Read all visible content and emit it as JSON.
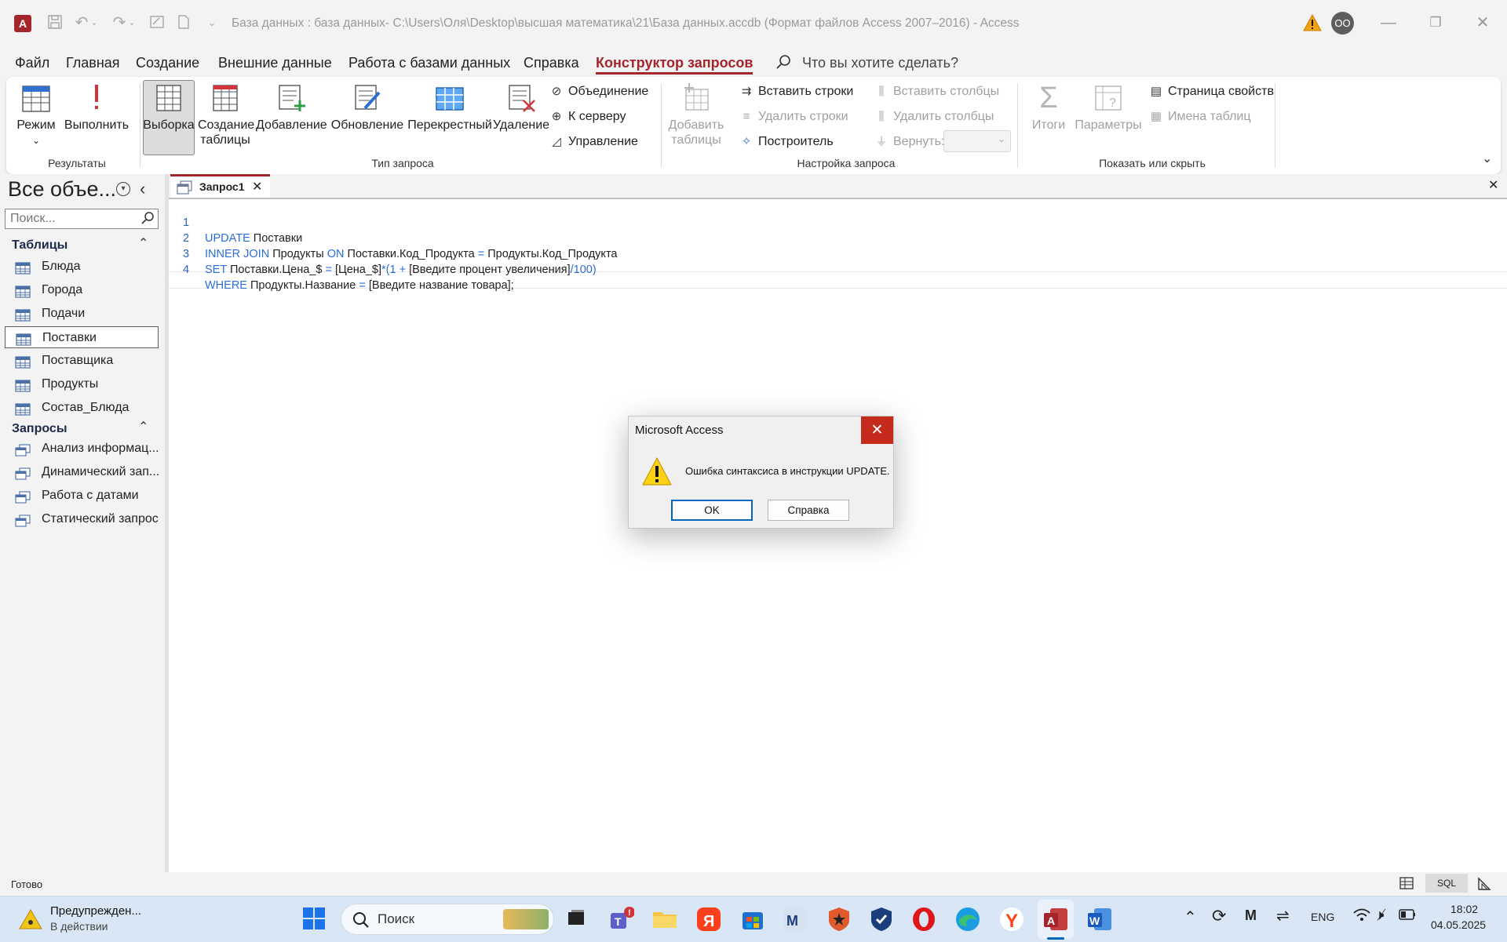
{
  "window": {
    "title": "База данных : база данных- C:\\Users\\Оля\\Desktop\\высшая математика\\21\\База данных.accdb (Формат файлов Access 2007–2016)  -  Access",
    "user_initials": "OO",
    "app_icon_letter": "A"
  },
  "menu": {
    "tabs": [
      "Файл",
      "Главная",
      "Создание",
      "Внешние данные",
      "Работа с базами данных",
      "Справка",
      "Конструктор запросов"
    ],
    "active_tab": "Конструктор запросов",
    "tell_me": "Что вы хотите сделать?"
  },
  "ribbon": {
    "results_group": {
      "label": "Результаты",
      "view": "Режим",
      "run": "Выполнить"
    },
    "query_type_group": {
      "label": "Тип запроса",
      "select": "Выборка",
      "make_table_1": "Создание",
      "make_table_2": "таблицы",
      "append": "Добавление",
      "update": "Обновление",
      "crosstab": "Перекрестный",
      "delete": "Удаление",
      "union": "Объединение",
      "pass_through": "К серверу",
      "data_definition": "Управление"
    },
    "setup_group": {
      "label": "Настройка запроса",
      "add_tables_1": "Добавить",
      "add_tables_2": "таблицы",
      "insert_rows": "Вставить строки",
      "delete_rows": "Удалить строки",
      "builder": "Построитель",
      "insert_columns": "Вставить столбцы",
      "delete_columns": "Удалить столбцы",
      "return": "Вернуть:"
    },
    "show_hide_group": {
      "label": "Показать или скрыть",
      "totals": "Итоги",
      "parameters": "Параметры",
      "property_sheet": "Страница свойств",
      "table_names": "Имена таблиц"
    }
  },
  "nav": {
    "header": "Все объе...",
    "search_placeholder": "Поиск...",
    "tables_section": "Таблицы",
    "tables": [
      "Блюда",
      "Города",
      "Подачи",
      "Поставки",
      "Поставщика",
      "Продукты",
      "Состав_Блюда"
    ],
    "selected_table": "Поставки",
    "queries_section": "Запросы",
    "queries": [
      "Анализ информац...",
      "Динамический зап...",
      "Работа с датами",
      "Статический запрос"
    ]
  },
  "document": {
    "tab_label": "Запрос1",
    "line_numbers": [
      "1",
      "2",
      "3",
      "4"
    ],
    "sql": {
      "l1_kw": "UPDATE",
      "l1_rest": " Поставки",
      "l2_kw1": "INNER JOIN",
      "l2_a": " Продукты ",
      "l2_kw2": "ON",
      "l2_b": " Поставки.Код_Продукта ",
      "l2_op": "=",
      "l2_c": " Продукты.Код_Продукта",
      "l3_kw": "SET",
      "l3_a": " Поставки.Цена_$ ",
      "l3_op1": "=",
      "l3_b": " [Цена_$]",
      "l3_op2": "*(1 +",
      "l3_c": " [Введите процент увеличения]",
      "l3_op3": "/100)",
      "l4_kw": "WHERE",
      "l4_a": " Продукты.Название ",
      "l4_op": "=",
      "l4_b": " [Введите название товара]",
      "l4_end": ";"
    }
  },
  "dialog": {
    "title": "Microsoft Access",
    "message": "Ошибка синтаксиса в инструкции UPDATE.",
    "ok": "OK",
    "help": "Справка"
  },
  "statusbar": {
    "status": "Готово",
    "sql_view": "SQL"
  },
  "taskbar": {
    "notification_title": "Предупрежден...",
    "notification_sub": "В действии",
    "search_placeholder": "Поиск",
    "lang": "ENG",
    "time": "18:02",
    "date": "04.05.2025"
  },
  "colors": {
    "accent": "#a4262c",
    "keyword": "#2b6fd6",
    "dialog_close": "#c42b1c",
    "taskbar": "#d9e6f5"
  }
}
